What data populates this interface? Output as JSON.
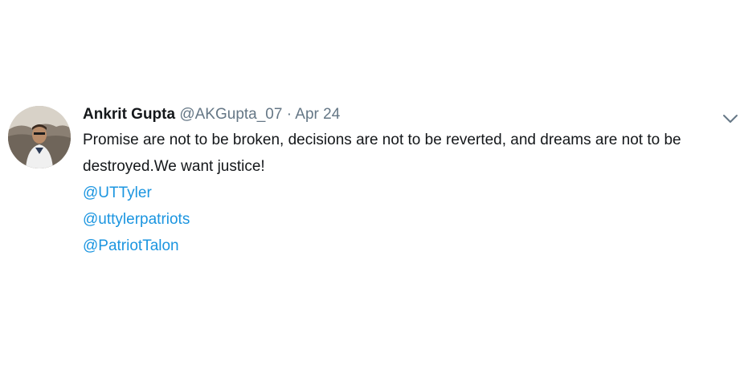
{
  "tweet": {
    "author_name": "Ankrit Gupta",
    "author_handle": "@AKGupta_07",
    "separator": "·",
    "date": "Apr 24",
    "text": "Promise are not to be broken, decisions are not to be reverted, and dreams are not to be destroyed.We want justice!",
    "mentions": [
      "@UTTyler",
      "@uttylerpatriots",
      "@PatriotTalon"
    ],
    "menu_icon": "chevron-down-icon",
    "avatar_icon": "avatar"
  },
  "colors": {
    "text": "#14171a",
    "secondary": "#657786",
    "link": "#1b95e0",
    "background": "#ffffff"
  }
}
